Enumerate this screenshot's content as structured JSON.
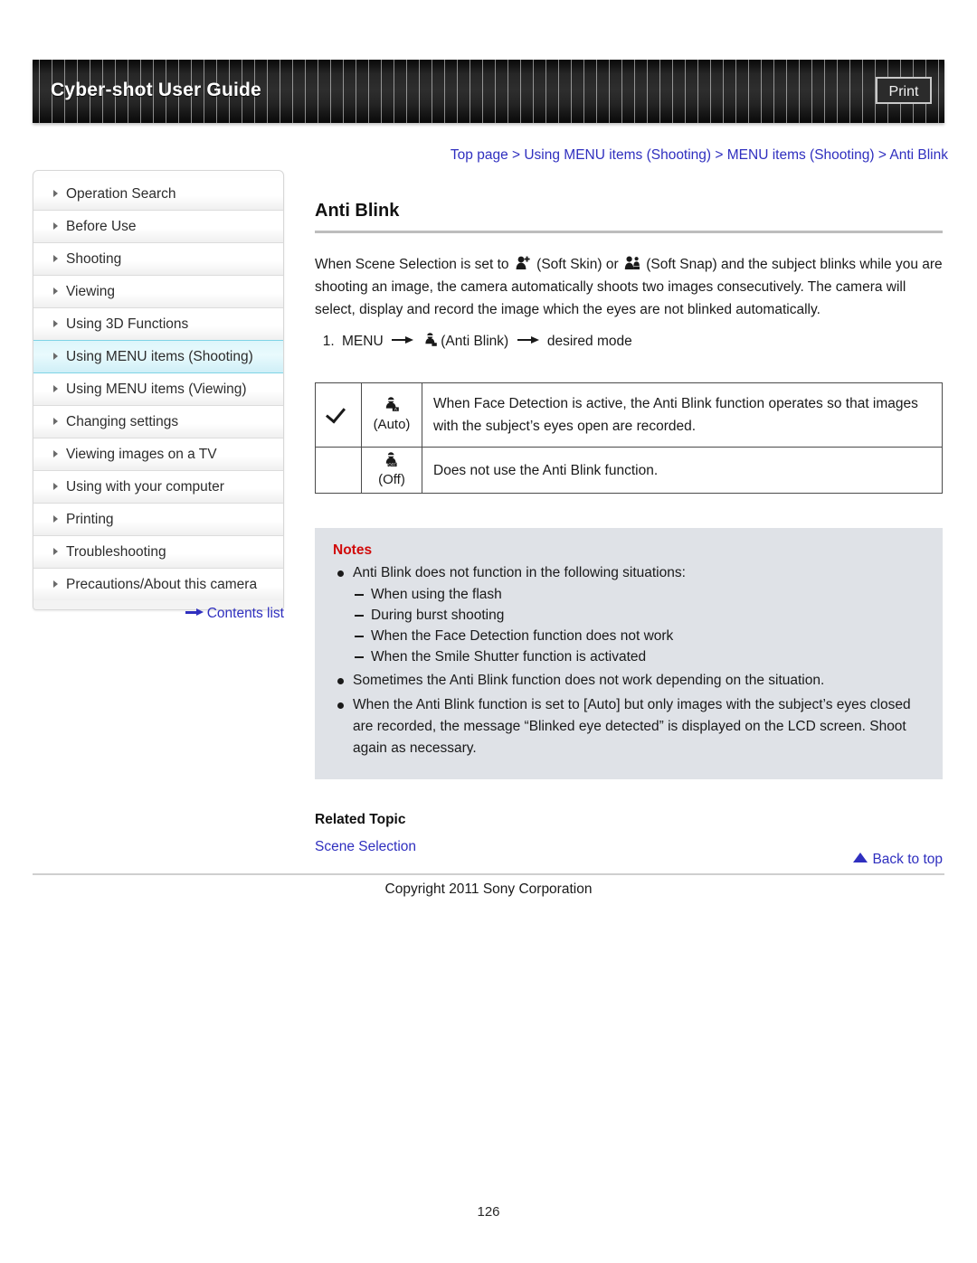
{
  "header": {
    "title": "Cyber-shot User Guide",
    "print_label": "Print"
  },
  "breadcrumb": {
    "items": [
      "Top page",
      "Using MENU items (Shooting)",
      "MENU items (Shooting)",
      "Anti Blink"
    ],
    "separator": ">"
  },
  "sidebar": {
    "items": [
      {
        "label": "Operation Search",
        "selected": false
      },
      {
        "label": "Before Use",
        "selected": false
      },
      {
        "label": "Shooting",
        "selected": false
      },
      {
        "label": "Viewing",
        "selected": false
      },
      {
        "label": "Using 3D Functions",
        "selected": false
      },
      {
        "label": "Using MENU items (Shooting)",
        "selected": true
      },
      {
        "label": "Using MENU items (Viewing)",
        "selected": false
      },
      {
        "label": "Changing settings",
        "selected": false
      },
      {
        "label": "Viewing images on a TV",
        "selected": false
      },
      {
        "label": "Using with your computer",
        "selected": false
      },
      {
        "label": "Printing",
        "selected": false
      },
      {
        "label": "Troubleshooting",
        "selected": false
      },
      {
        "label": "Precautions/About this camera",
        "selected": false
      }
    ],
    "contents_link": "Contents list"
  },
  "main": {
    "title": "Anti Blink",
    "intro_part1": "When Scene Selection is set to",
    "intro_part2": "(Soft Skin) or",
    "intro_part3": "(Soft Snap) and the subject blinks while you are shooting an image, the camera automatically shoots two images consecutively. The camera will select, display and record the image which the eyes are not blinked automatically.",
    "step_number": "1.",
    "step_menu": "MENU",
    "step_label": "(Anti Blink)",
    "step_result": "desired mode",
    "table": {
      "rows": [
        {
          "checked": true,
          "check_glyph": "checkmark-icon",
          "icon": "anti-blink-auto-icon",
          "mode": "(Auto)",
          "description": "When Face Detection is active, the Anti Blink function operates so that images with the subject’s eyes open are recorded."
        },
        {
          "checked": false,
          "check_glyph": "",
          "icon": "anti-blink-off-icon",
          "mode": "(Off)",
          "description": "Does not use the Anti Blink function."
        }
      ]
    },
    "notes": {
      "title": "Notes",
      "items": [
        {
          "text": "Anti Blink does not function in the following situations:",
          "sub": [
            "When using the flash",
            "During burst shooting",
            "When the Face Detection function does not work",
            "When the Smile Shutter function is activated"
          ]
        },
        {
          "text": "Sometimes the Anti Blink function does not work depending on the situation.",
          "sub": []
        },
        {
          "text": "When the Anti Blink function is set to [Auto] but only images with the subject’s eyes closed are recorded, the message “Blinked eye detected” is displayed on the LCD screen. Shoot again as necessary.",
          "sub": []
        }
      ]
    },
    "related": {
      "title": "Related Topic",
      "link": "Scene Selection"
    }
  },
  "footer": {
    "back_to_top": "Back to top",
    "copyright": "Copyright 2011 Sony Corporation",
    "page_number": "126"
  },
  "colors": {
    "link": "#2f2fbf",
    "notes_title": "#d10a0a",
    "notes_bg": "#dfe2e7",
    "selected_sidebar": "#ddf6fb"
  }
}
